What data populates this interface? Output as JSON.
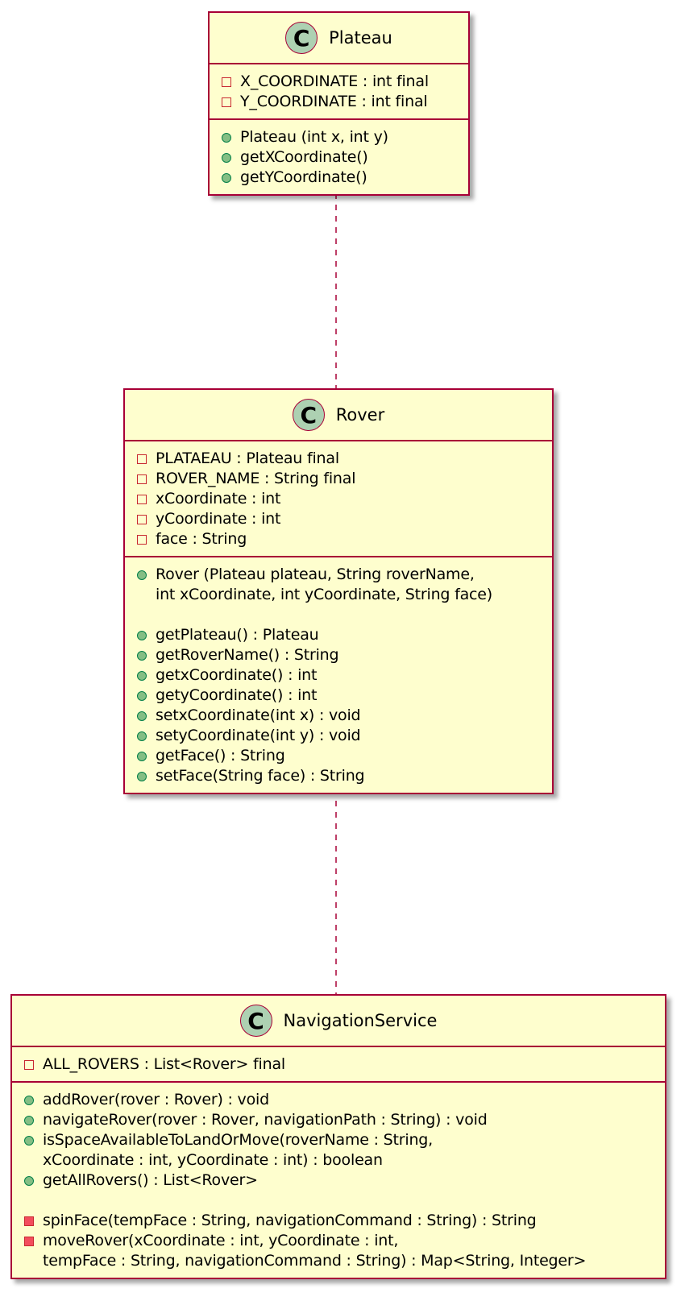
{
  "colors": {
    "class_fill": "#FEFECE",
    "class_border": "#A80036",
    "class_icon_fill": "#ADD1B2",
    "private_field_marker": "#C82930",
    "public_method_marker": "#84BE84",
    "private_method_marker": "#F24D5C",
    "connector": "#A80036"
  },
  "classes": [
    {
      "icon": "C",
      "name": "Plateau",
      "fields": [
        {
          "visibility": "private",
          "text": "X_COORDINATE : int final"
        },
        {
          "visibility": "private",
          "text": "Y_COORDINATE : int final"
        }
      ],
      "methods": [
        {
          "visibility": "public",
          "text": "Plateau (int x, int y)"
        },
        {
          "visibility": "public",
          "text": "getXCoordinate()"
        },
        {
          "visibility": "public",
          "text": "getYCoordinate()"
        }
      ]
    },
    {
      "icon": "C",
      "name": "Rover",
      "fields": [
        {
          "visibility": "private",
          "text": "PLATAEAU : Plateau final"
        },
        {
          "visibility": "private",
          "text": "ROVER_NAME : String final"
        },
        {
          "visibility": "private",
          "text": "xCoordinate : int"
        },
        {
          "visibility": "private",
          "text": "yCoordinate : int"
        },
        {
          "visibility": "private",
          "text": "face : String"
        }
      ],
      "methods": [
        {
          "visibility": "public",
          "text": "Rover (Plateau plateau, String roverName,"
        },
        {
          "visibility": "none",
          "text": "int xCoordinate, int yCoordinate, String face)"
        },
        {
          "visibility": "blank",
          "text": ""
        },
        {
          "visibility": "public",
          "text": "getPlateau() : Plateau"
        },
        {
          "visibility": "public",
          "text": "getRoverName() : String"
        },
        {
          "visibility": "public",
          "text": "getxCoordinate() : int"
        },
        {
          "visibility": "public",
          "text": "getyCoordinate() : int"
        },
        {
          "visibility": "public",
          "text": "setxCoordinate(int x) : void"
        },
        {
          "visibility": "public",
          "text": "setyCoordinate(int y) : void"
        },
        {
          "visibility": "public",
          "text": "getFace() : String"
        },
        {
          "visibility": "public",
          "text": "setFace(String face) : String"
        }
      ]
    },
    {
      "icon": "C",
      "name": "NavigationService",
      "fields": [
        {
          "visibility": "private",
          "text": "ALL_ROVERS : List<Rover> final"
        }
      ],
      "methods": [
        {
          "visibility": "public",
          "text": "addRover(rover : Rover) : void"
        },
        {
          "visibility": "public",
          "text": "navigateRover(rover : Rover, navigationPath : String) : void"
        },
        {
          "visibility": "public",
          "text": "isSpaceAvailableToLandOrMove(roverName : String,"
        },
        {
          "visibility": "none",
          "text": "xCoordinate : int, yCoordinate : int) : boolean"
        },
        {
          "visibility": "public",
          "text": "getAllRovers() : List<Rover>"
        },
        {
          "visibility": "blank",
          "text": ""
        },
        {
          "visibility": "private-method",
          "text": "spinFace(tempFace : String, navigationCommand : String) : String"
        },
        {
          "visibility": "private-method",
          "text": "moveRover(xCoordinate : int, yCoordinate : int,"
        },
        {
          "visibility": "none",
          "text": "tempFace : String, navigationCommand : String) : Map<String, Integer>"
        }
      ]
    }
  ],
  "relations": [
    {
      "from": "Plateau",
      "to": "Rover",
      "style": "dashed"
    },
    {
      "from": "Rover",
      "to": "NavigationService",
      "style": "dashed"
    }
  ]
}
